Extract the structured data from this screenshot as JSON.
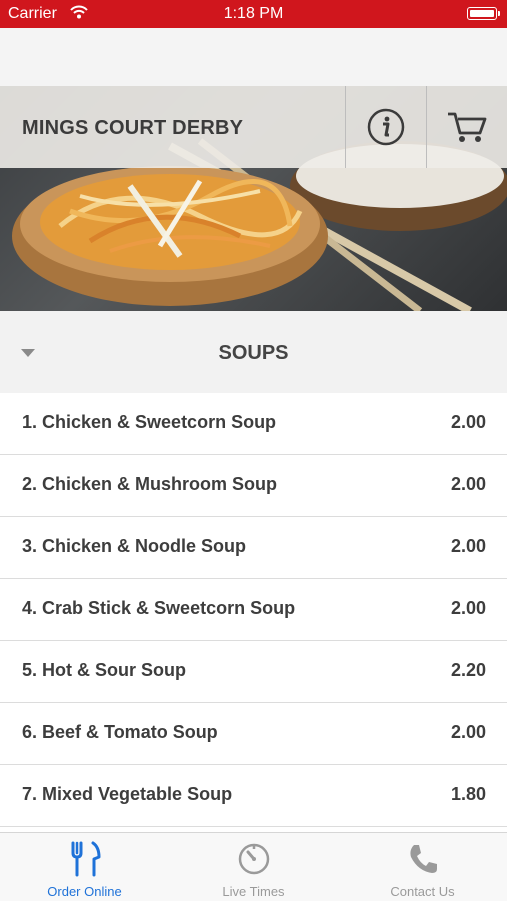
{
  "status_bar": {
    "carrier": "Carrier",
    "time": "1:18 PM"
  },
  "header": {
    "title": "MINGS COURT DERBY",
    "info_icon": "info-icon",
    "cart_icon": "cart-icon"
  },
  "category": {
    "title": "SOUPS",
    "expanded": true
  },
  "menu_items": [
    {
      "name": "1. Chicken & Sweetcorn Soup",
      "price": "2.00"
    },
    {
      "name": "2. Chicken & Mushroom Soup",
      "price": "2.00"
    },
    {
      "name": "3. Chicken & Noodle Soup",
      "price": "2.00"
    },
    {
      "name": "4. Crab Stick & Sweetcorn Soup",
      "price": "2.00"
    },
    {
      "name": "5. Hot & Sour Soup",
      "price": "2.20"
    },
    {
      "name": "6. Beef & Tomato Soup",
      "price": "2.00"
    },
    {
      "name": "7. Mixed Vegetable Soup",
      "price": "1.80"
    }
  ],
  "tab_bar": {
    "tabs": [
      {
        "label": "Order Online",
        "icon": "fork-knife-icon",
        "active": true
      },
      {
        "label": "Live Times",
        "icon": "timer-icon",
        "active": false
      },
      {
        "label": "Contact Us",
        "icon": "phone-icon",
        "active": false
      }
    ]
  },
  "colors": {
    "status_bar": "#d0161d",
    "active_tab": "#1f72d8",
    "inactive_tab": "#9a9a9a"
  }
}
